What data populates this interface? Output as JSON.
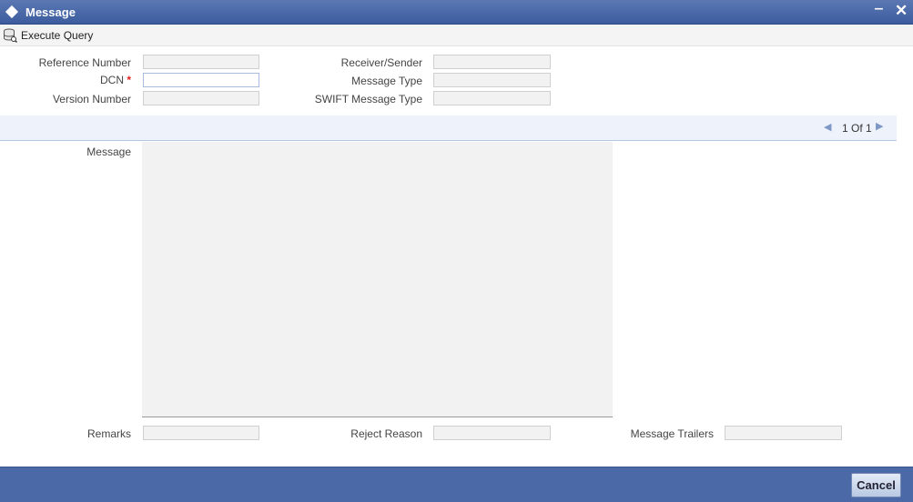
{
  "window": {
    "title": "Message",
    "minimize_label": "‒",
    "close_label": "✕"
  },
  "toolbar": {
    "execute_query_label": "Execute Query"
  },
  "form": {
    "reference_number": {
      "label": "Reference Number",
      "value": ""
    },
    "dcn": {
      "label": "DCN",
      "required_mark": "*",
      "value": ""
    },
    "version_number": {
      "label": "Version Number",
      "value": ""
    },
    "receiver_sender": {
      "label": "Receiver/Sender",
      "value": ""
    },
    "message_type": {
      "label": "Message Type",
      "value": ""
    },
    "swift_message_type": {
      "label": "SWIFT Message Type",
      "value": ""
    }
  },
  "pager": {
    "prev_glyph": "◀",
    "text": "1 Of 1",
    "next_glyph": "▶"
  },
  "message": {
    "label": "Message",
    "value": ""
  },
  "bottom": {
    "remarks": {
      "label": "Remarks",
      "value": ""
    },
    "reject_reason": {
      "label": "Reject Reason",
      "value": ""
    },
    "message_trailers": {
      "label": "Message Trailers",
      "value": ""
    }
  },
  "footer": {
    "cancel_label": "Cancel"
  },
  "colors": {
    "titlebar": "#3c5c9e",
    "footer": "#4b69a6",
    "field_bg": "#f2f2f2",
    "required": "#dd2222"
  },
  "icons": {
    "window_icon": "diamond-icon",
    "execute_query_icon": "database-query-icon"
  }
}
